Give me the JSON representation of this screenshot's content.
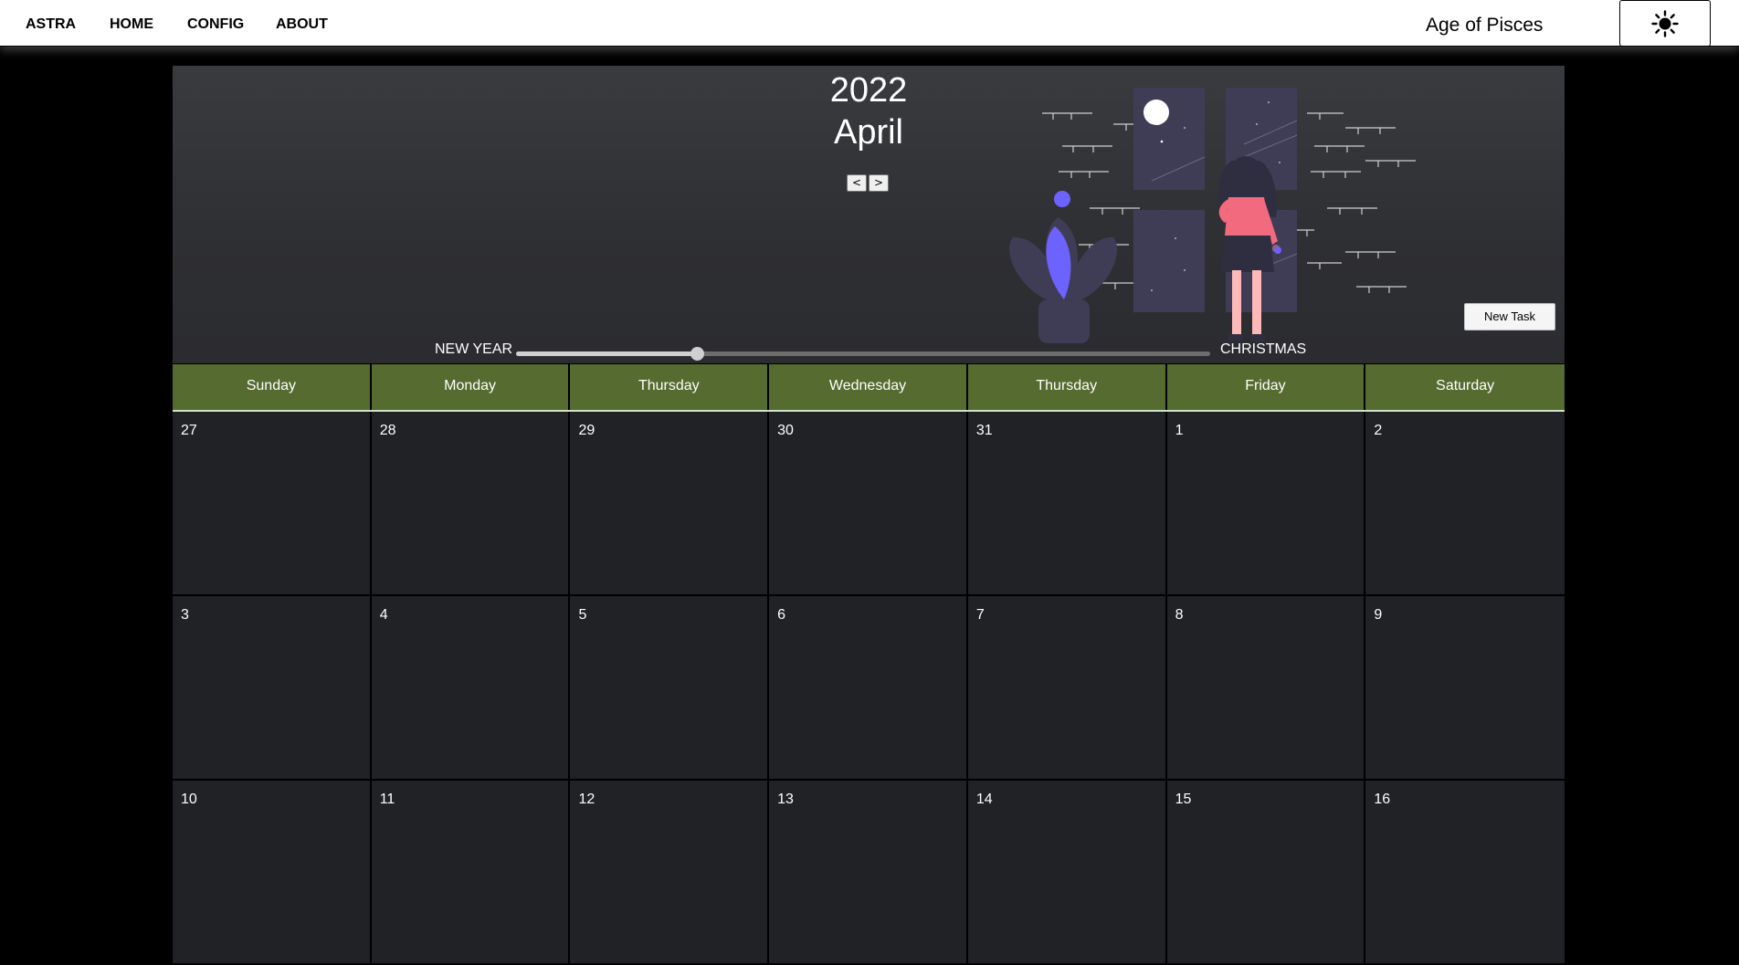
{
  "navbar": {
    "links": [
      "ASTRA",
      "HOME",
      "CONFIG",
      "ABOUT"
    ],
    "title": "Age of Pisces",
    "theme_icon": "sun-icon"
  },
  "header": {
    "year": "2022",
    "month": "April",
    "prev_label": "<",
    "next_label": ">",
    "new_task_label": "New Task",
    "slider": {
      "left_label": "NEW YEAR",
      "right_label": "CHRISTMAS",
      "value_fraction": 0.26
    },
    "illustration": "woman-at-window-illustration"
  },
  "calendar": {
    "weekdays": [
      "Sunday",
      "Monday",
      "Thursday",
      "Wednesday",
      "Thursday",
      "Friday",
      "Saturday"
    ],
    "weeks": [
      [
        "27",
        "28",
        "29",
        "30",
        "31",
        "1",
        "2"
      ],
      [
        "3",
        "4",
        "5",
        "6",
        "7",
        "8",
        "9"
      ],
      [
        "10",
        "11",
        "12",
        "13",
        "14",
        "15",
        "16"
      ]
    ]
  },
  "colors": {
    "header_bg": "#556b2f",
    "cell_bg": "#212226",
    "panel_bg": "#2e2f33",
    "accent": "#6c63ff",
    "figure_shirt": "#f26a7d"
  }
}
